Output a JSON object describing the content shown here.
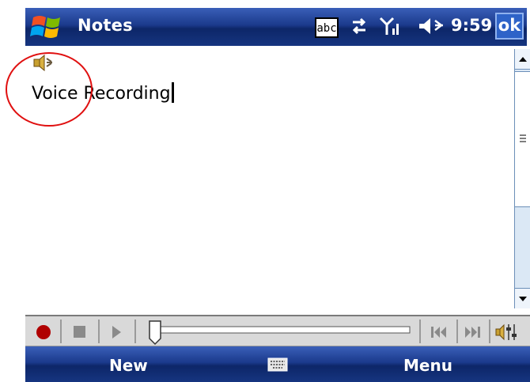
{
  "titlebar": {
    "app_title": "Notes",
    "input_mode": "abc",
    "clock": "9:59",
    "ok_label": "ok",
    "icons": [
      "start-menu-icon",
      "connectivity-icon",
      "signal-icon",
      "volume-icon"
    ]
  },
  "note": {
    "recording_icon": "speaker-icon",
    "text": "Voice Recording"
  },
  "player": {
    "buttons": [
      "record-icon",
      "stop-icon",
      "play-icon",
      "skip-back-icon",
      "skip-forward-icon",
      "volume-settings-icon"
    ],
    "position": 0.0
  },
  "softkeys": {
    "left": "New",
    "center_icon": "keyboard-icon",
    "right": "Menu"
  },
  "colors": {
    "bar_dark": "#0d2668",
    "bar_light": "#3a5fb8",
    "annotation": "#e01010",
    "record": "#b00000"
  }
}
